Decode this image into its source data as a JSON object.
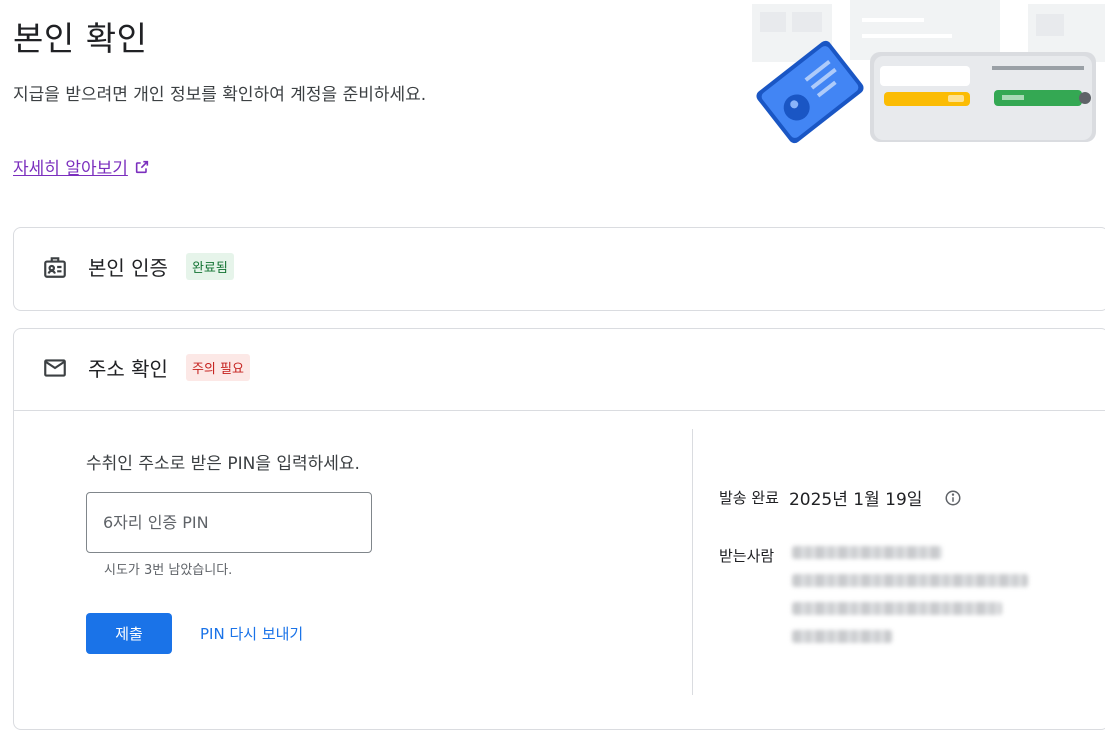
{
  "header": {
    "title": "본인 확인",
    "description": "지급을 받으려면 개인 정보를 확인하여 계정을 준비하세요.",
    "learn_more": "자세히 알아보기"
  },
  "identity_card": {
    "title": "본인 인증",
    "badge": "완료됨",
    "icon": "id-card-icon"
  },
  "address_card": {
    "title": "주소 확인",
    "badge": "주의 필요",
    "icon": "mail-icon",
    "pin_prompt": "수취인 주소로 받은 PIN을 입력하세요.",
    "pin_placeholder": "6자리 인증 PIN",
    "pin_value": "",
    "attempts_text": "시도가 3번 남았습니다.",
    "submit_label": "제출",
    "resend_label": "PIN 다시 보내기",
    "sent_label": "발송 완료",
    "sent_date": "2025년 1월 19일",
    "recipient_label": "받는사람"
  },
  "colors": {
    "primary": "#1a73e8",
    "link_visited": "#7b2fbe",
    "success_bg": "#e6f4ea",
    "success_text": "#137333",
    "warning_bg": "#fce8e6",
    "warning_text": "#c5221f",
    "border": "#dadce0"
  }
}
